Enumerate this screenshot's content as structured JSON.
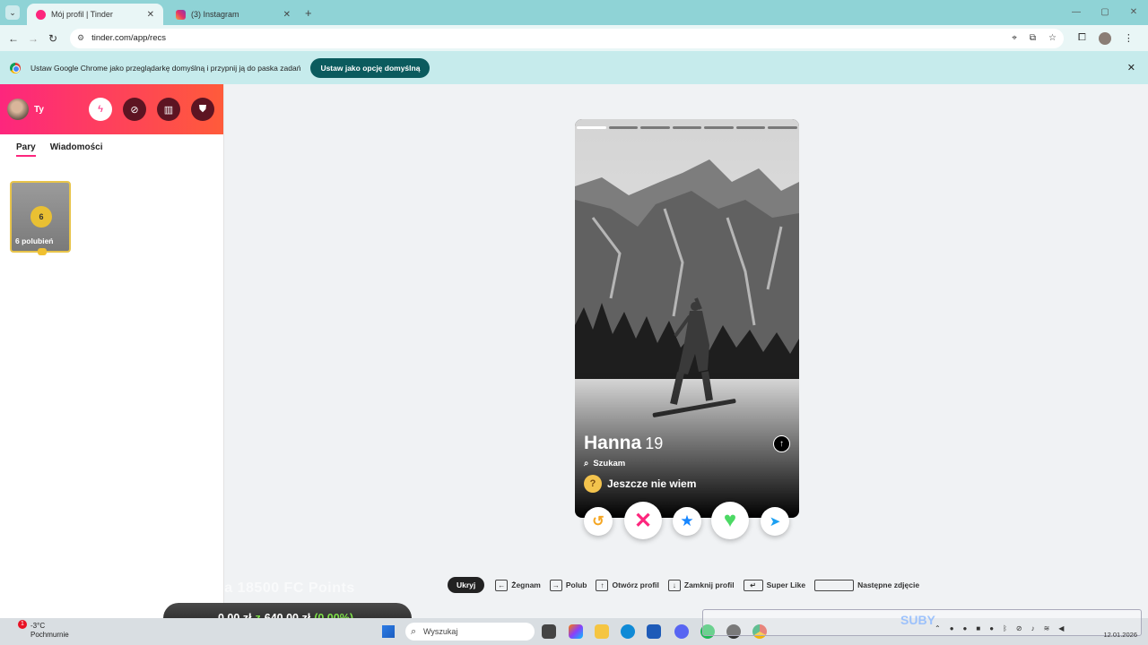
{
  "browser": {
    "tabs": [
      {
        "title": "Mój profil | Tinder",
        "active": true
      },
      {
        "title": "(3) Instagram",
        "active": false
      }
    ],
    "url": "tinder.com/app/recs",
    "infobar": {
      "message": "Ustaw Google Chrome jako przeglądarkę domyślną i przypnij ją do paska zadań",
      "button": "Ustaw jako opcję domyślną"
    }
  },
  "sidebar": {
    "user_label": "Ty",
    "tabs": [
      "Pary",
      "Wiadomości"
    ],
    "likes": {
      "count": "6",
      "label": "6 polubień"
    }
  },
  "card": {
    "name": "Hanna",
    "age": "19",
    "looking_for": "Szukam",
    "intent": "Jeszcze nie wiem",
    "photo_count": 7,
    "active_photo": 0
  },
  "hints": {
    "hide": "Ukryj",
    "items": [
      {
        "key": "←",
        "label": "Żegnam"
      },
      {
        "key": "→",
        "label": "Polub"
      },
      {
        "key": "↑",
        "label": "Otwórz profil"
      },
      {
        "key": "↓",
        "label": "Zamknij profil"
      },
      {
        "key": "↵",
        "label": "Super Like"
      },
      {
        "key": "",
        "label": "Następne zdjęcie"
      }
    ]
  },
  "overlay": {
    "caption": "na 18500 FC Points",
    "amount": "0,00 zł",
    "separator": "z",
    "total": "640,00 zł",
    "percent": "(0.00%)",
    "tray_label": "SUBY"
  },
  "taskbar": {
    "temperature": "-3°C",
    "weather": "Pochmurnie",
    "weather_badge": "1",
    "search_placeholder": "Wyszukaj",
    "date": "12.01.2026"
  },
  "colors": {
    "brand_gradient_start": "#fd267d",
    "brand_gradient_end": "#ff5b3a",
    "likes_gold": "#e8c44a",
    "like_green": "#4cd964",
    "nope_pink": "#fd267d",
    "superlike_blue": "#1786ff"
  }
}
